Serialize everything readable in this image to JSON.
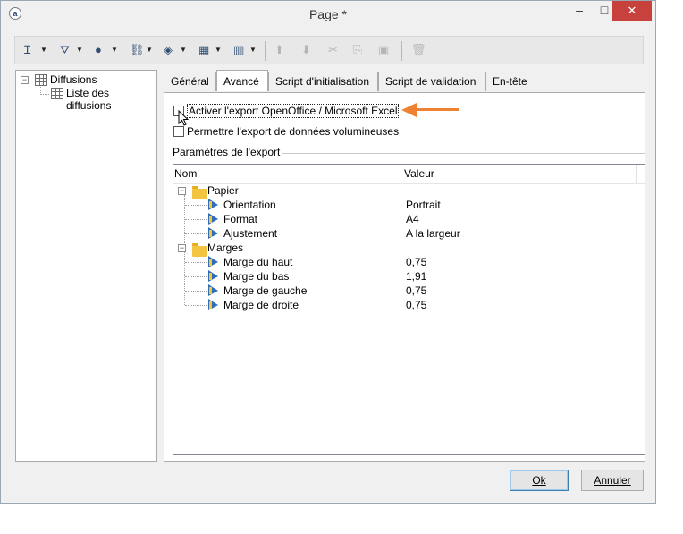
{
  "window": {
    "title": "Page *",
    "app_icon": "adobe-campaign-icon"
  },
  "toolbar": {
    "tools": [
      {
        "name": "text-cursor-icon",
        "glyph": "Ɪ"
      },
      {
        "name": "filter-tool-icon",
        "glyph": "⛛"
      },
      {
        "name": "globe-icon",
        "glyph": "●"
      },
      {
        "name": "link-icon",
        "glyph": "⛓"
      },
      {
        "name": "layers-icon",
        "glyph": "◈"
      },
      {
        "name": "table-icon",
        "glyph": "▦"
      },
      {
        "name": "columns-icon",
        "glyph": "▥"
      }
    ],
    "disabled_tools": [
      {
        "name": "move-up-icon",
        "glyph": "⬆"
      },
      {
        "name": "move-down-icon",
        "glyph": "⬇"
      },
      {
        "name": "cut-icon",
        "glyph": "✂"
      },
      {
        "name": "copy-icon",
        "glyph": "⎘"
      },
      {
        "name": "paste-icon",
        "glyph": "📋"
      },
      {
        "name": "delete-icon",
        "glyph": "🗑"
      }
    ]
  },
  "tree": {
    "root": {
      "label": "Diffusions",
      "expander": "⊟"
    },
    "child": {
      "label": "Liste des diffusions"
    }
  },
  "tabs": [
    "Général",
    "Avancé",
    "Script d'initialisation",
    "Script de validation",
    "En-tête"
  ],
  "active_tab": "Avancé",
  "options": {
    "export_label": "Activer l'export OpenOffice / Microsoft Excel",
    "export_checked": false,
    "volume_label": "Permettre l'export de données volumineuses",
    "volume_checked": false
  },
  "export_params": {
    "group_title": "Paramètres de l'export",
    "col_name": "Nom",
    "col_value": "Valeur",
    "groups": [
      {
        "label": "Papier",
        "items": [
          {
            "name": "Orientation",
            "value": "Portrait"
          },
          {
            "name": "Format",
            "value": "A4"
          },
          {
            "name": "Ajustement",
            "value": "A la largeur"
          }
        ]
      },
      {
        "label": "Marges",
        "items": [
          {
            "name": "Marge du haut",
            "value": "0,75"
          },
          {
            "name": "Marge du bas",
            "value": "1,91"
          },
          {
            "name": "Marge de gauche",
            "value": "0,75"
          },
          {
            "name": "Marge de droite",
            "value": "0,75"
          }
        ]
      }
    ]
  },
  "buttons": {
    "ok": "Ok",
    "cancel": "Annuler"
  },
  "colors": {
    "annotation_arrow": "#ee8132",
    "close_button": "#c7423d"
  }
}
